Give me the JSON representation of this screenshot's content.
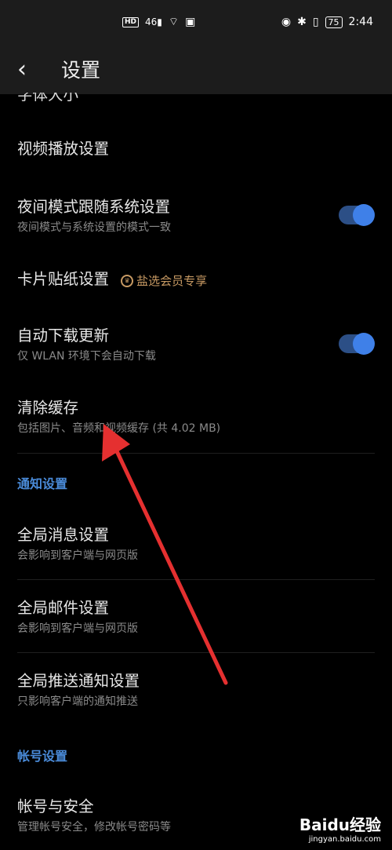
{
  "status_bar": {
    "hd": "HD",
    "signal": "46",
    "battery": "75",
    "time": "2:44"
  },
  "header": {
    "title": "设置"
  },
  "rows": {
    "cut_off": "字体大小",
    "video": {
      "title": "视频播放设置"
    },
    "night": {
      "title": "夜间模式跟随系统设置",
      "subtitle": "夜间模式与系统设置的模式一致"
    },
    "sticker": {
      "title": "卡片贴纸设置",
      "badge": "盐选会员专享"
    },
    "autodl": {
      "title": "自动下载更新",
      "subtitle": "仅 WLAN 环境下会自动下载"
    },
    "cache": {
      "title": "清除缓存",
      "subtitle": "包括图片、音频和视频缓存 (共 4.02 MB)"
    },
    "global_msg": {
      "title": "全局消息设置",
      "subtitle": "会影响到客户端与网页版"
    },
    "global_mail": {
      "title": "全局邮件设置",
      "subtitle": "会影响到客户端与网页版"
    },
    "global_push": {
      "title": "全局推送通知设置",
      "subtitle": "只影响客户端的通知推送"
    },
    "account": {
      "title": "帐号与安全",
      "subtitle": "管理帐号安全，修改帐号密码等"
    }
  },
  "sections": {
    "notify": "通知设置",
    "account": "帐号设置"
  },
  "toggles": {
    "night": 1,
    "autodl": 1
  },
  "watermark": {
    "logo": "Baidu经验",
    "url": "jingyan.baidu.com"
  },
  "colors": {
    "accent": "#3f80e8",
    "section": "#4a8bd9",
    "annotation": "#e53030",
    "badge": "#c89a63"
  }
}
